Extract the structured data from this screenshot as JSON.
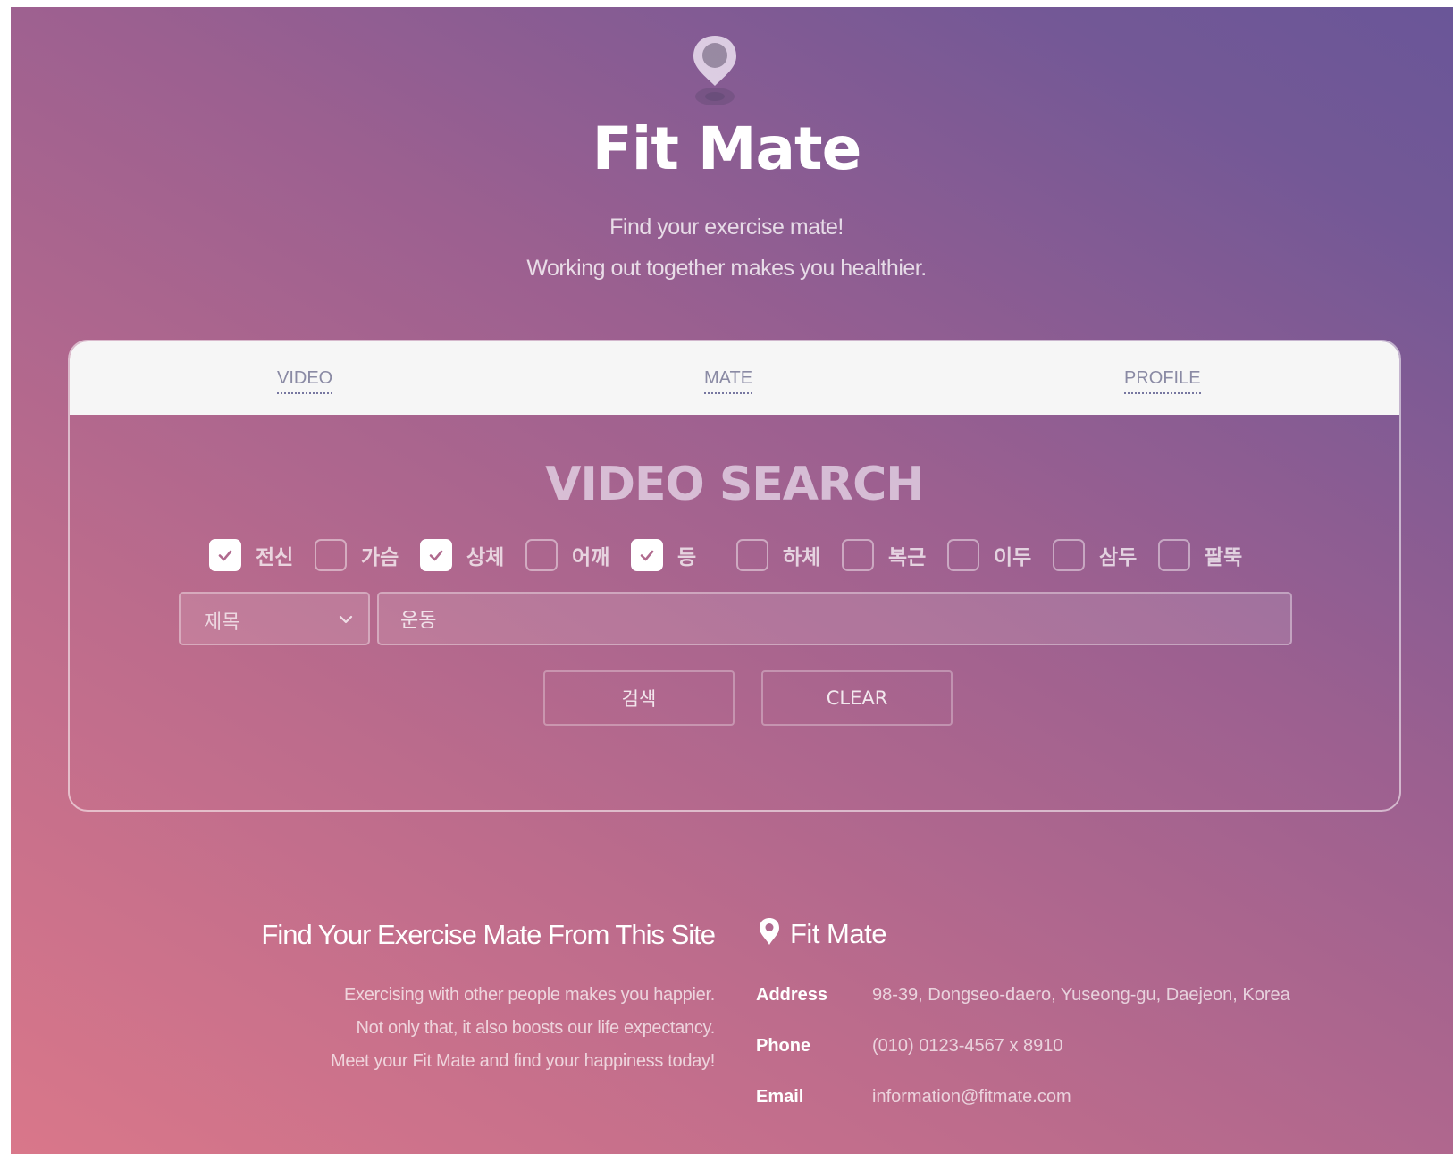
{
  "header": {
    "title": "Fit Mate",
    "tagline_1": "Find your exercise mate!",
    "tagline_2": "Working out together makes you healthier."
  },
  "tabs": [
    {
      "label": "VIDEO"
    },
    {
      "label": "MATE"
    },
    {
      "label": "PROFILE"
    }
  ],
  "search": {
    "title": "VIDEO SEARCH",
    "categories": [
      {
        "label": "전신",
        "checked": true
      },
      {
        "label": "가슴",
        "checked": false
      },
      {
        "label": "상체",
        "checked": true
      },
      {
        "label": "어깨",
        "checked": false
      },
      {
        "label": "등",
        "checked": true
      },
      {
        "label": "하체",
        "checked": false
      },
      {
        "label": "복근",
        "checked": false
      },
      {
        "label": "이두",
        "checked": false
      },
      {
        "label": "삼두",
        "checked": false
      },
      {
        "label": "팔뚝",
        "checked": false
      }
    ],
    "field_select": "제목",
    "query_value": "운동",
    "search_button": "검색",
    "clear_button": "CLEAR"
  },
  "footer": {
    "heading": "Find Your Exercise Mate From This Site",
    "para_1": "Exercising with other people makes you happier.",
    "para_2": "Not only that, it also boosts our life expectancy.",
    "para_3": "Meet your Fit Mate and find your happiness today!",
    "brand": "Fit Mate",
    "address_label": "Address",
    "address": "98-39, Dongseo-daero, Yuseong-gu, Daejeon, Korea",
    "phone_label": "Phone",
    "phone": "(010) 0123-4567 x 8910",
    "email_label": "Email",
    "email": "information@fitmate.com"
  },
  "icons": {
    "logo": "map-pin-icon",
    "checkbox": "check-icon",
    "dropdown": "chevron-down-icon",
    "footer_brand": "map-pin-icon"
  },
  "colors": {
    "gradient_start": "#d9778a",
    "gradient_end": "#6a5698",
    "tab_bar": "#f6f6f6"
  }
}
